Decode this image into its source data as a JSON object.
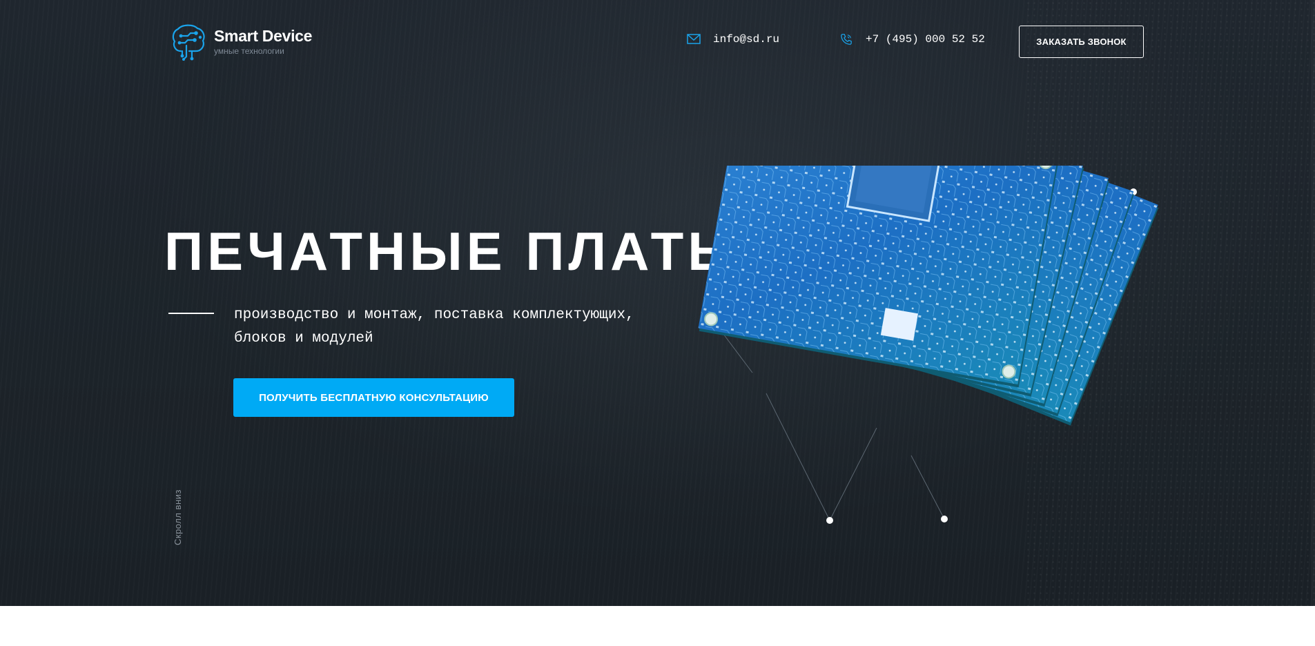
{
  "header": {
    "logo_name": "Smart Device",
    "logo_tagline": "умные технологии",
    "email": "info@sd.ru",
    "phone": "+7 (495) 000 52 52",
    "call_button": "ЗАКАЗАТЬ ЗВОНОК"
  },
  "hero": {
    "title": "ПЕЧАТНЫЕ ПЛАТЫ",
    "subtitle": "производство и монтаж, поставка комплектующих, блоков и модулей",
    "cta_button": "ПОЛУЧИТЬ БЕСПЛАТНУЮ КОНСУЛЬТАЦИЮ",
    "scroll_hint": "Скролл вниз"
  },
  "icons": {
    "logo": "brain-circuit-icon",
    "email": "envelope-icon",
    "phone": "phone-icon"
  },
  "colors": {
    "accent": "#00aaf5",
    "hero_background": "#1e252c",
    "text": "#ffffff",
    "muted": "#7f8a96"
  }
}
